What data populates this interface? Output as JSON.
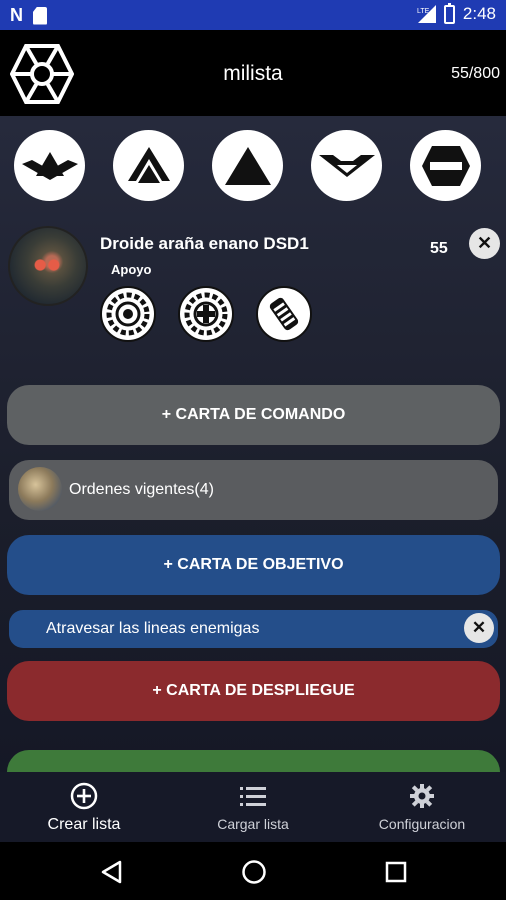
{
  "status_bar": {
    "time": "2:48",
    "network_label": "LTE",
    "icons": [
      "n-icon",
      "sd-card-icon",
      "signal-icon",
      "battery-icon"
    ]
  },
  "app_bar": {
    "title": "milista",
    "points": "55/800",
    "logo_icon": "separatist-logo-icon"
  },
  "filters": [
    {
      "name": "commander-rank-icon"
    },
    {
      "name": "operative-rank-icon"
    },
    {
      "name": "corps-rank-icon"
    },
    {
      "name": "special-forces-rank-icon"
    },
    {
      "name": "support-rank-icon"
    }
  ],
  "unit": {
    "name": "Droide araña enano DSD1",
    "role": "Apoyo",
    "points": "55",
    "remove_glyph": "✕",
    "upgrades": [
      {
        "name": "comms-upgrade-icon"
      },
      {
        "name": "hardpoint-upgrade-icon"
      },
      {
        "name": "ordnance-upgrade-icon"
      }
    ]
  },
  "buttons": {
    "command": "+ CARTA DE COMANDO",
    "objective": "+ CARTA DE OBJETIVO",
    "deployment": "+ CARTA DE DESPLIEGUE"
  },
  "command_card": {
    "label": "Ordenes vigentes(4)"
  },
  "objective_card": {
    "label": "Atravesar las lineas enemigas",
    "remove_glyph": "✕"
  },
  "bottom_nav": [
    {
      "label": "Crear lista",
      "icon": "add-circle-icon",
      "active": true
    },
    {
      "label": "Cargar lista",
      "icon": "list-icon",
      "active": false
    },
    {
      "label": "Configuracion",
      "icon": "gear-icon",
      "active": false
    }
  ],
  "colors": {
    "status_bar": "#1f3bb3",
    "command_button": "#5e6163",
    "objective_button": "#244e8a",
    "deployment_button": "#8b2a2d",
    "green_button": "#3e7a3a"
  }
}
